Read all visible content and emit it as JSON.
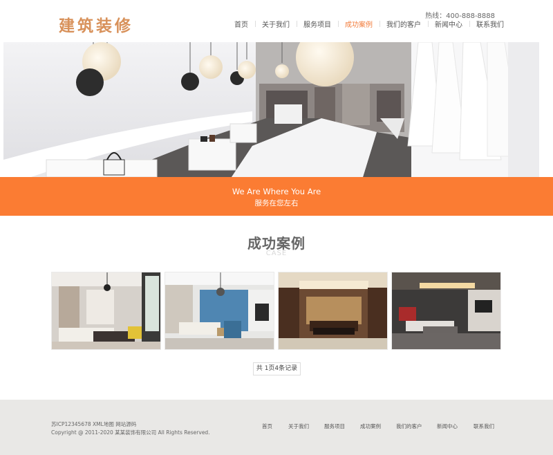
{
  "header": {
    "logo": "建筑装修",
    "hotline": "热线：400-888-8888",
    "nav": [
      {
        "label": "首页",
        "active": false
      },
      {
        "label": "关于我们",
        "active": false
      },
      {
        "label": "服务项目",
        "active": false
      },
      {
        "label": "成功案例",
        "active": true
      },
      {
        "label": "我们的客户",
        "active": false
      },
      {
        "label": "新闻中心",
        "active": false
      },
      {
        "label": "联系我们",
        "active": false
      }
    ]
  },
  "slogan": {
    "en": "We Are Where You Are",
    "cn": "服务在您左右"
  },
  "section": {
    "title": "成功案例",
    "subtitle": "CASE"
  },
  "cases": [
    {
      "image": "living-room-with-yellow-chairs"
    },
    {
      "image": "living-room-with-blue-wall"
    },
    {
      "image": "chinese-style-living-room"
    },
    {
      "image": "modern-living-room-dark"
    }
  ],
  "pagination": {
    "text": "共 1页4条记录"
  },
  "footer": {
    "icp_line": "苏ICP12345678 XML地图 网站源码",
    "copyright": "Copyright @ 2011-2020 某某装饰有限公司 All Rights Reserved.",
    "links": [
      "首页",
      "关于我们",
      "服务项目",
      "成功案例",
      "我们的客户",
      "新闻中心",
      "联系我们"
    ]
  },
  "colors": {
    "accent": "#fb7c33",
    "logo": "#d8915a",
    "footer_bg": "#e9e8e6"
  }
}
